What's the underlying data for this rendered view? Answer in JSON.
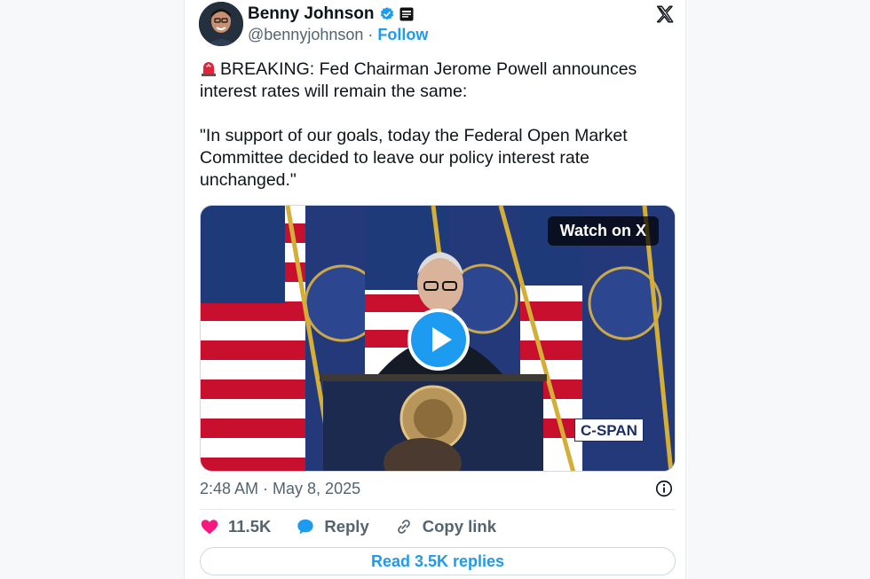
{
  "author": {
    "name": "Benny Johnson",
    "handle": "@bennyjohnson",
    "follow_label": "Follow",
    "separator": "·"
  },
  "tweet": {
    "text": "BREAKING: Fed Chairman Jerome Powell announces interest rates will remain the same:\n\n\"In support of our goals, today the Federal Open Market Committee decided to leave our policy interest rate unchanged.\""
  },
  "media": {
    "watch_label": "Watch on X",
    "broadcaster": "C-SPAN"
  },
  "meta": {
    "timestamp": "2:48 AM · May 8, 2025"
  },
  "actions": {
    "likes": "11.5K",
    "reply_label": "Reply",
    "copy_label": "Copy link"
  },
  "read_replies_label": "Read 3.5K replies",
  "colors": {
    "accent": "#1d9bf0",
    "like": "#f91880",
    "text": "#0f1419",
    "muted": "#536471"
  }
}
